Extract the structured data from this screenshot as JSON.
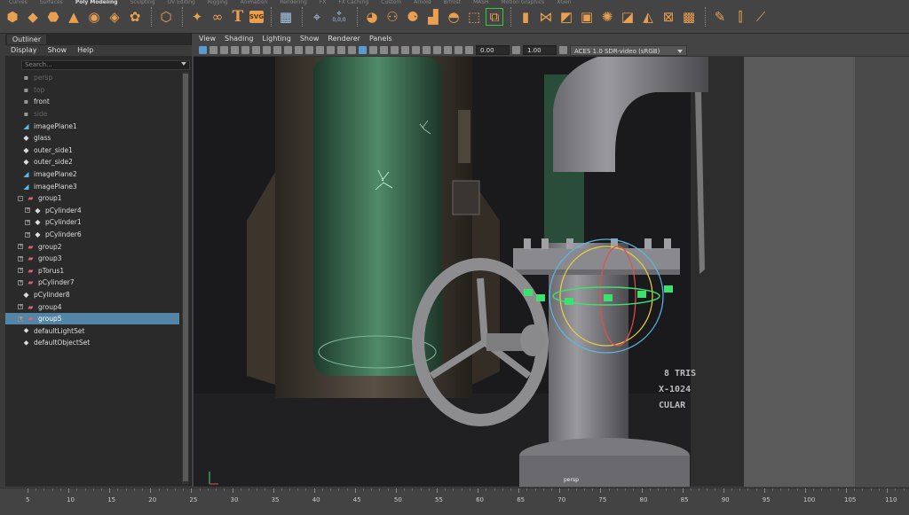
{
  "shelf": {
    "tabs": [
      "Curves",
      "Surfaces",
      "Poly Modeling",
      "Sculpting",
      "UV Editing",
      "Rigging",
      "Animation",
      "Rendering",
      "FX",
      "FX Caching",
      "Custom",
      "Arnold",
      "Bifrost",
      "MASH",
      "Motion Graphics",
      "XGen"
    ],
    "active_tab": "Poly Modeling",
    "svg_label": "SVG",
    "text_icon_label": "T",
    "uv_readout": "0,0,0"
  },
  "outliner": {
    "tab_label": "Outliner",
    "menu": [
      "Display",
      "Show",
      "Help"
    ],
    "search_placeholder": "Search...",
    "items": [
      {
        "label": "persp",
        "icon": "camera-icon",
        "kind": "cam",
        "indent": 0,
        "dim": true
      },
      {
        "label": "top",
        "icon": "camera-icon",
        "kind": "cam",
        "indent": 0,
        "dim": true
      },
      {
        "label": "front",
        "icon": "camera-icon",
        "kind": "cam",
        "indent": 0,
        "dim": false
      },
      {
        "label": "side",
        "icon": "camera-icon",
        "kind": "cam",
        "indent": 0,
        "dim": true
      },
      {
        "label": "imagePlane1",
        "icon": "image-plane-icon",
        "kind": "img",
        "indent": 0,
        "dim": false
      },
      {
        "label": "glass",
        "icon": "mesh-icon",
        "kind": "mesh",
        "indent": 0,
        "dim": false
      },
      {
        "label": "outer_side1",
        "icon": "mesh-icon",
        "kind": "mesh",
        "indent": 0,
        "dim": false
      },
      {
        "label": "outer_side2",
        "icon": "mesh-icon",
        "kind": "mesh",
        "indent": 0,
        "dim": false
      },
      {
        "label": "imagePlane2",
        "icon": "image-plane-icon",
        "kind": "img",
        "indent": 0,
        "dim": false
      },
      {
        "label": "imagePlane3",
        "icon": "image-plane-icon",
        "kind": "img",
        "indent": 0,
        "dim": false
      },
      {
        "label": "group1",
        "icon": "group-icon",
        "kind": "grp",
        "indent": 0,
        "expander": "-",
        "dim": false
      },
      {
        "label": "pCylinder4",
        "icon": "mesh-icon",
        "kind": "mesh",
        "indent": 1,
        "expander": "+",
        "dim": false
      },
      {
        "label": "pCylinder1",
        "icon": "mesh-icon",
        "kind": "mesh",
        "indent": 1,
        "expander": "+",
        "dim": false
      },
      {
        "label": "pCylinder6",
        "icon": "mesh-icon",
        "kind": "mesh",
        "indent": 1,
        "expander": "+",
        "dim": false
      },
      {
        "label": "group2",
        "icon": "group-icon",
        "kind": "grp",
        "indent": 0,
        "expander": "+",
        "dim": false
      },
      {
        "label": "group3",
        "icon": "group-icon",
        "kind": "grp",
        "indent": 0,
        "expander": "+",
        "dim": false
      },
      {
        "label": "pTorus1",
        "icon": "group-icon",
        "kind": "grp",
        "indent": 0,
        "expander": "+",
        "dim": false
      },
      {
        "label": "pCylinder7",
        "icon": "group-icon",
        "kind": "grp",
        "indent": 0,
        "expander": "+",
        "dim": false
      },
      {
        "label": "pCylinder8",
        "icon": "mesh-icon",
        "kind": "mesh",
        "indent": 0,
        "dim": false
      },
      {
        "label": "group4",
        "icon": "group-icon",
        "kind": "grp",
        "indent": 0,
        "expander": "+",
        "dim": false
      },
      {
        "label": "group5",
        "icon": "group-icon",
        "kind": "grp",
        "indent": 0,
        "expander": "+",
        "dim": false,
        "selected": true
      },
      {
        "label": "defaultLightSet",
        "icon": "set-icon",
        "kind": "set",
        "indent": 0,
        "dim": false
      },
      {
        "label": "defaultObjectSet",
        "icon": "set-icon",
        "kind": "set",
        "indent": 0,
        "dim": false
      }
    ]
  },
  "viewport": {
    "menu": [
      "View",
      "Shading",
      "Lighting",
      "Show",
      "Renderer",
      "Panels"
    ],
    "exposure": "0.00",
    "gamma": "1.00",
    "color_space": "ACES 1.0 SDR-video (sRGB)",
    "camera": "persp",
    "decal_text": [
      "8 TRIS",
      "X-1024",
      "CULAR"
    ]
  },
  "timeline": {
    "ticks": [
      "5",
      "10",
      "15",
      "20",
      "25",
      "30",
      "35",
      "40",
      "45",
      "50",
      "55",
      "60",
      "65",
      "70",
      "75",
      "80",
      "85",
      "90",
      "95",
      "100",
      "105",
      "110"
    ]
  },
  "colors": {
    "selection": "#5285a6",
    "shelf_icon": "#e8a050",
    "manipulator_blue": "#5ab8e8",
    "manipulator_red": "#e05050",
    "manipulator_yellow": "#e8d040",
    "manipulator_green": "#40e070"
  }
}
